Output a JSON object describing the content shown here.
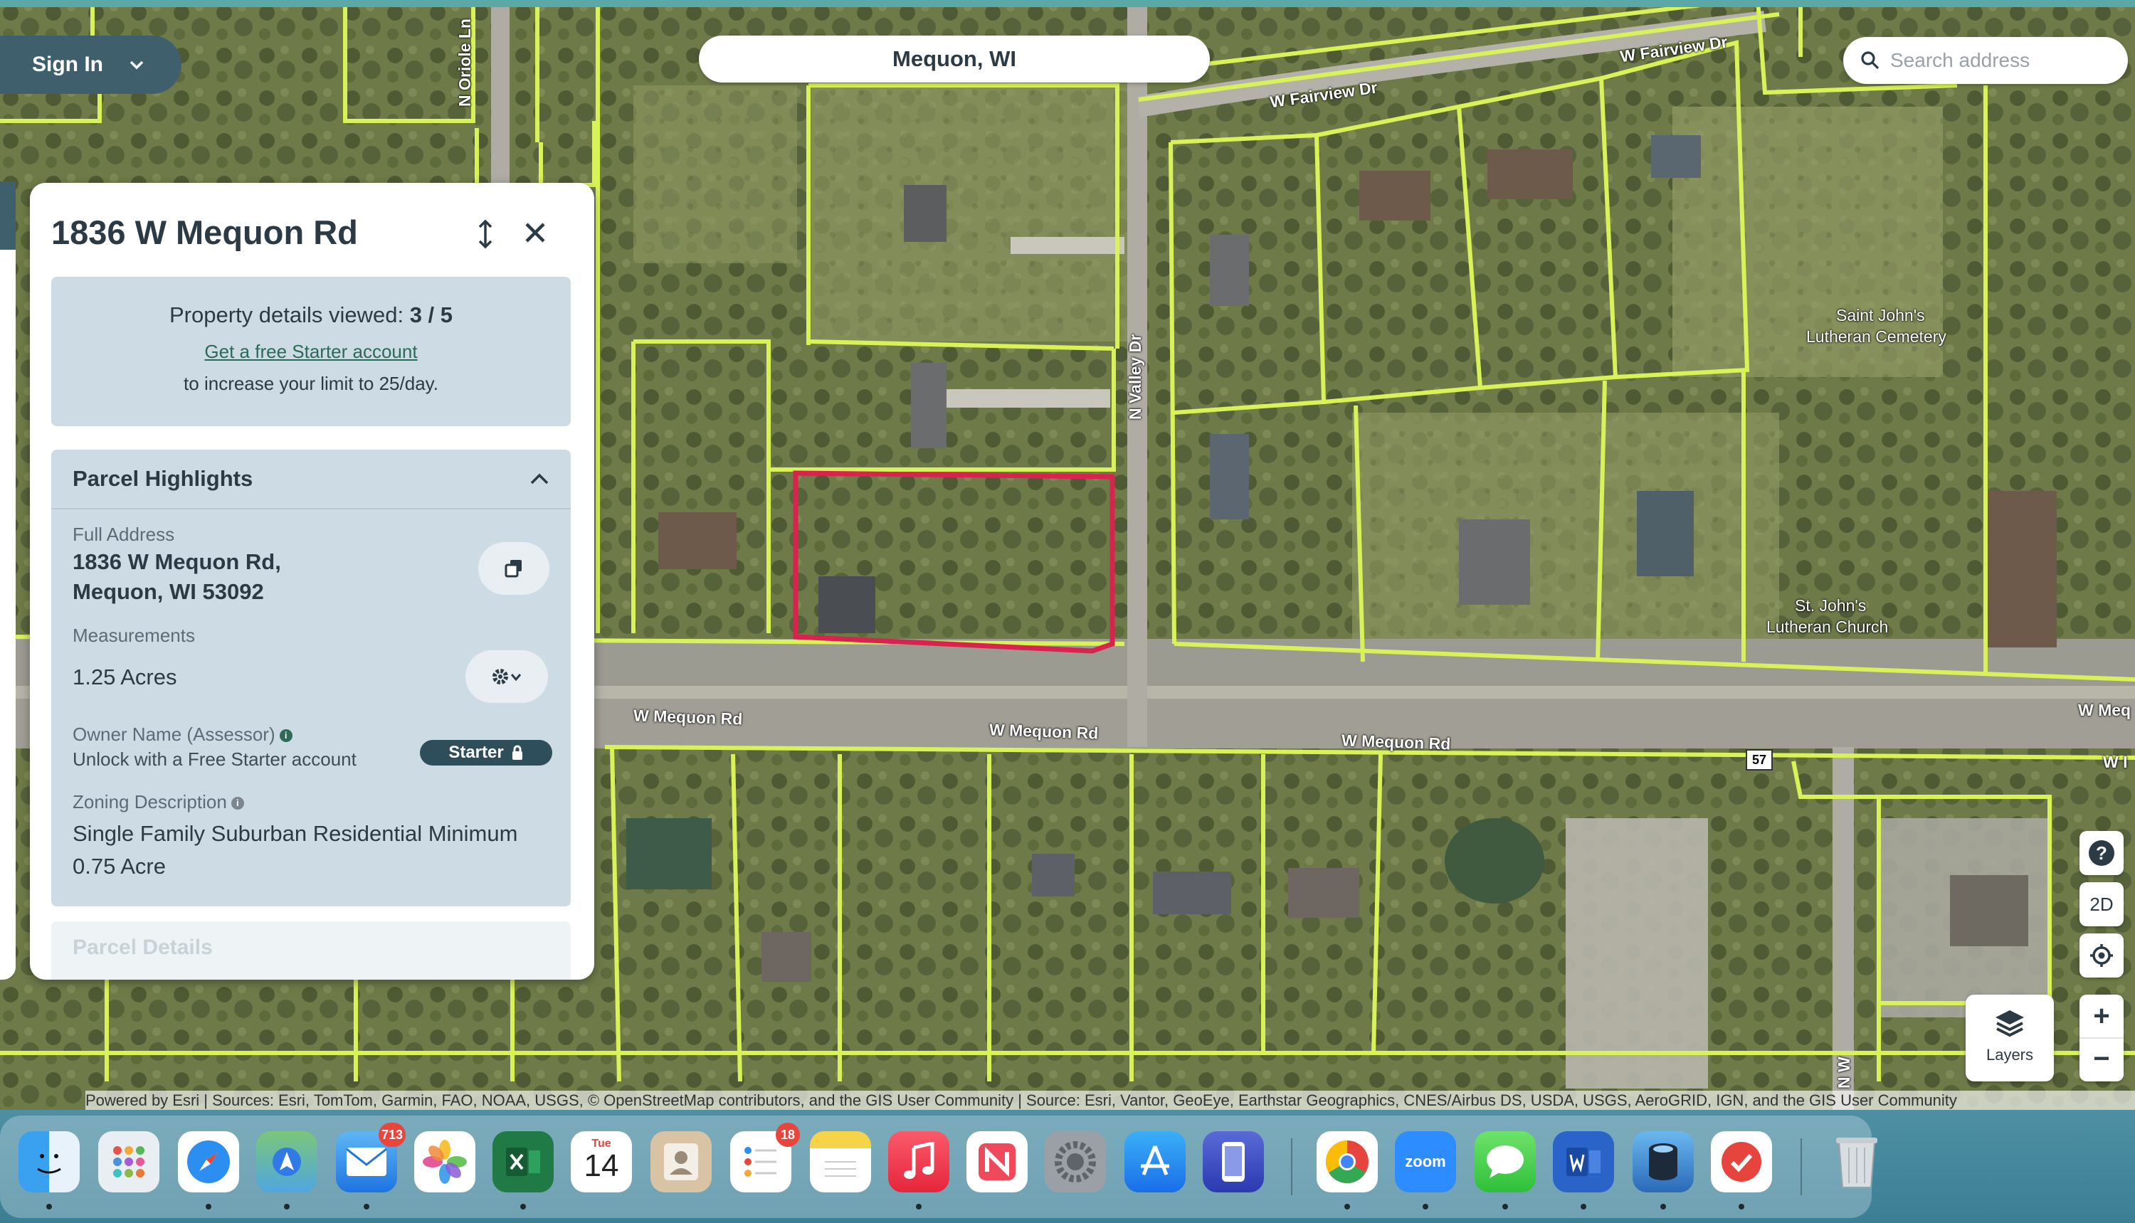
{
  "top": {
    "signin_label": "Sign In",
    "location_label": "Mequon, WI",
    "search_placeholder": "Search address"
  },
  "panel": {
    "title": "1836 W Mequon Rd",
    "views_text": "Property details viewed:",
    "views_count": "3 / 5",
    "starter_link": "Get a free Starter account",
    "limit_text": "to increase your limit to 25/day.",
    "highlights_title": "Parcel Highlights",
    "full_address_label": "Full Address",
    "full_address_line1": "1836 W Mequon Rd,",
    "full_address_line2": "Mequon, WI 53092",
    "measurements_label": "Measurements",
    "measurements_value": "1.25 Acres",
    "owner_label": "Owner Name (Assessor)",
    "owner_value": "Unlock with a Free Starter account",
    "starter_badge": "Starter",
    "zoning_label": "Zoning Description",
    "zoning_line1": "Single Family Suburban Residential Minimum",
    "zoning_line2": "0.75 Acre",
    "next_section": "Parcel Details"
  },
  "map": {
    "street_labels": [
      "W Fairview Dr",
      "W Fairview Dr",
      "N Oriole Ln",
      "N Valley Dr",
      "W Mequon Rd",
      "W Mequon Rd",
      "W Mequon Rd",
      "W Meq",
      "W I",
      "N W"
    ],
    "poi_labels": [
      "Saint John's",
      "Lutheran Cemetery",
      "St. John's",
      "Lutheran Church"
    ],
    "route_shield": "57",
    "parcel_line_color": "#d9f25a",
    "selected_parcel_color": "#d8234f",
    "attribution": "Powered by Esri | Sources: Esri, TomTom, Garmin, FAO, NOAA, USGS, © OpenStreetMap contributors, and the GIS User Community | Source: Esri, Vantor, GeoEye, Earthstar Geographics, CNES/Airbus DS, USDA, USGS, AeroGRID, IGN, and the GIS User Community"
  },
  "controls": {
    "help": "?",
    "view_mode": "2D",
    "zoom_in": "+",
    "zoom_out": "−",
    "layers_label": "Layers"
  },
  "dock": {
    "mail_badge": "713",
    "reminders_badge": "18",
    "calendar_month": "Tue",
    "calendar_day": "14",
    "zoom_label": "zoom"
  }
}
